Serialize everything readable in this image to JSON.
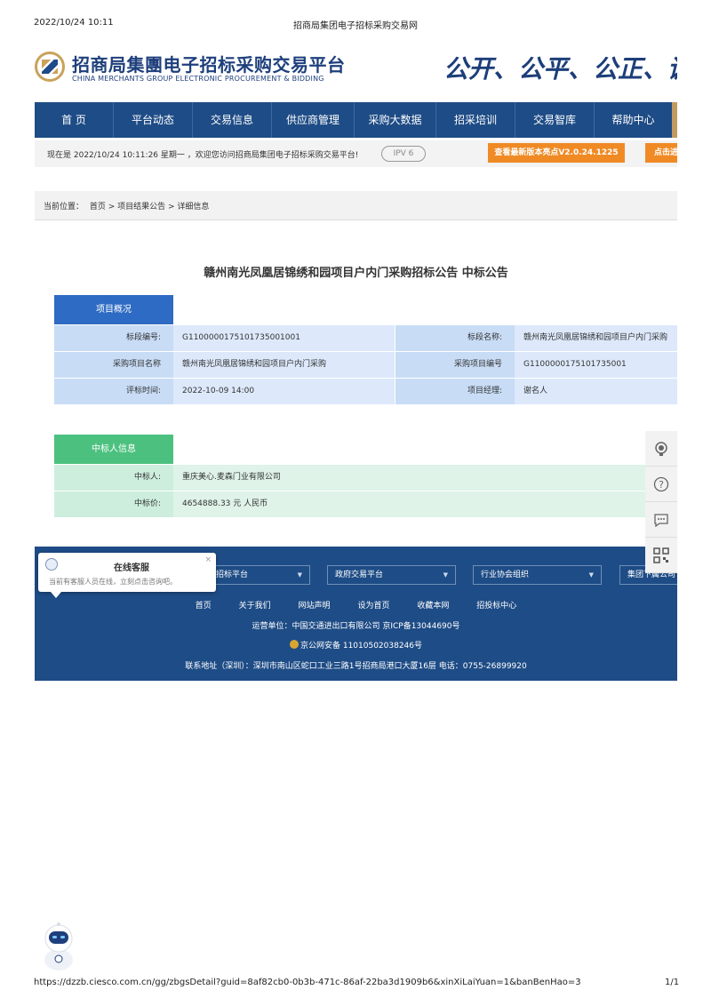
{
  "print_header": {
    "datetime": "2022/10/24 10:11",
    "page_title": "招商局集团电子招标采购交易网"
  },
  "print_footer": {
    "url": "https://dzzb.ciesco.com.cn/gg/zbgsDetail?guid=8af82cb0-0b3b-471c-86af-22ba3d1909b6&xinXiLaiYuan=1&banBenHao=3",
    "page_count": "1/1"
  },
  "header": {
    "logo_cn": "招商局集團电子招标采购交易平台",
    "logo_en": "CHINA MERCHANTS GROUP ELECTRONIC PROCUREMENT & BIDDING",
    "slogan": "公开、公平、公正、诚"
  },
  "nav": {
    "items": [
      "首 页",
      "平台动态",
      "交易信息",
      "供应商管理",
      "采购大数据",
      "招采培训",
      "交易智库",
      "帮助中心"
    ]
  },
  "infobar": {
    "now_text": "现在是 2022/10/24 10:11:26 星期一 ，欢迎您访问招商局集团电子招标采购交易平台!",
    "ipv6": "IPV 6",
    "version_button": "查看最新版本亮点V2.0.24.1225",
    "click_button": "点击进"
  },
  "breadcrumb": {
    "label": "当前位置：",
    "path": "首页 > 项目结果公告 > 详细信息"
  },
  "announcement": {
    "title": "赣州南光凤凰居锦绣和园项目户内门采购招标公告 中标公告",
    "overview_tab": "项目概况",
    "overview": {
      "section_no_label": "标段编号:",
      "section_no": "G1100000175101735001001",
      "section_name_label": "标段名称:",
      "section_name": "赣州南光凤凰居锦绣和园项目户内门采购",
      "project_name_label": "采购项目名称",
      "project_name": "赣州南光凤凰居锦绣和园项目户内门采购",
      "project_no_label": "采购项目编号",
      "project_no": "G1100000175101735001",
      "eval_time_label": "评标时间:",
      "eval_time": "2022-10-09 14:00",
      "manager_label": "项目经理:",
      "manager": "谢名人"
    },
    "winner_tab": "中标人信息",
    "winner": {
      "winner_label": "中标人:",
      "winner": "重庆美心.麦森门业有限公司",
      "price_label": "中标价:",
      "price": "4654888.33 元 人民币"
    }
  },
  "footer": {
    "selects": [
      "招标平台",
      "政府交易平台",
      "行业协会组织",
      "集团下属公司"
    ],
    "links": [
      "首页",
      "关于我们",
      "网站声明",
      "设为首页",
      "收藏本网",
      "招投标中心"
    ],
    "operator": "运营单位：中国交通进出口有限公司    京ICP备13044690号",
    "police": "京公网安备 11010502038246号",
    "address": "联系地址（深圳）：深圳市南山区蛇口工业三路1号招商局港口大厦16层  电话：0755-26899920"
  },
  "chat": {
    "title": "在线客服",
    "subtitle": "当前有客服人员在线，立刻点击咨询吧。",
    "close": "×"
  },
  "colors": {
    "nav": "#1e4c86",
    "accent_orange": "#f08a24",
    "overview_tab": "#2e6bc4",
    "winner_tab": "#4cc17f"
  }
}
